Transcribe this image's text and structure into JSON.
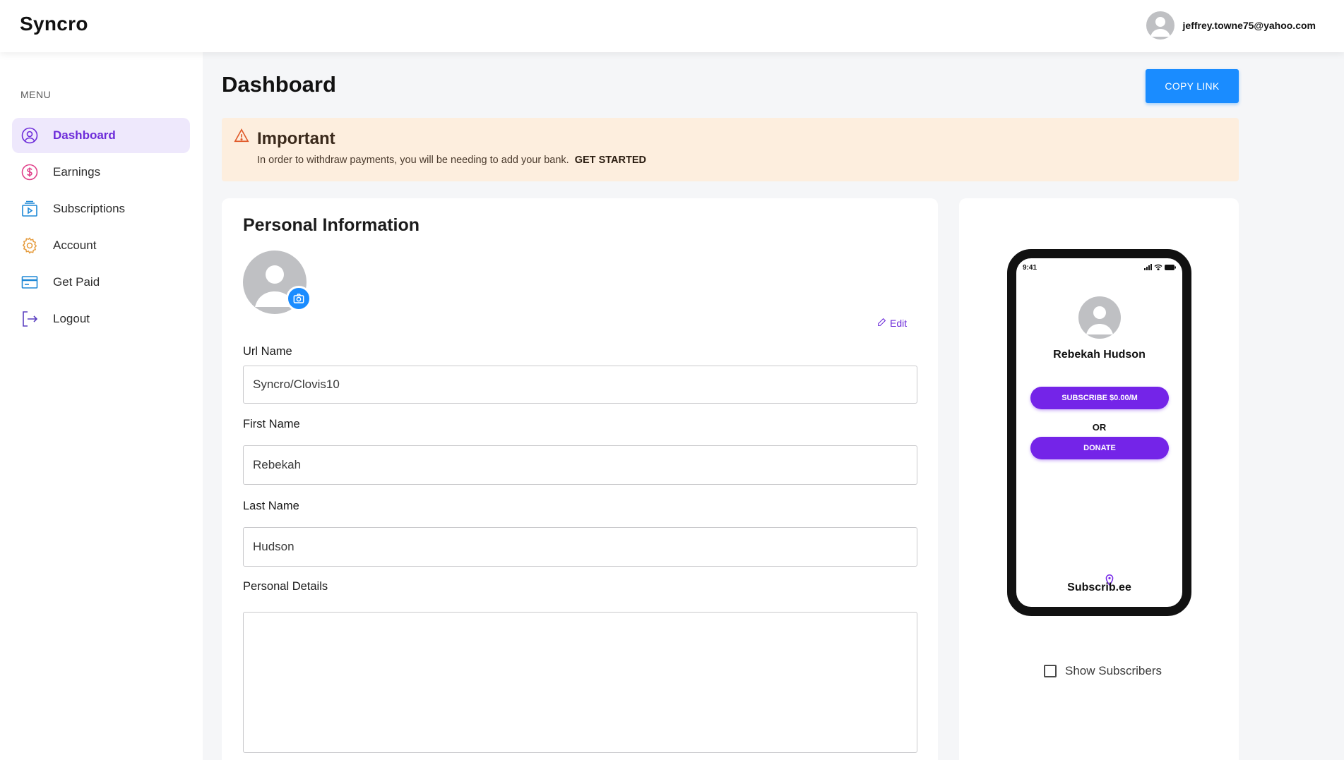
{
  "app": {
    "brand": "Syncro"
  },
  "user": {
    "email": "jeffrey.towne75@yahoo.com",
    "avatar_icon": "user-avatar-icon"
  },
  "sidebar": {
    "menu_label": "MENU",
    "items": [
      {
        "label": "Dashboard",
        "icon": "user-circle-icon",
        "active": true
      },
      {
        "label": "Earnings",
        "icon": "dollar-circle-icon",
        "active": false
      },
      {
        "label": "Subscriptions",
        "icon": "video-play-icon",
        "active": false
      },
      {
        "label": "Account",
        "icon": "gear-icon",
        "active": false
      },
      {
        "label": "Get Paid",
        "icon": "credit-card-icon",
        "active": false
      },
      {
        "label": "Logout",
        "icon": "logout-icon",
        "active": false
      }
    ]
  },
  "header": {
    "title": "Dashboard",
    "copy_link_label": "COPY LINK"
  },
  "alert": {
    "title": "Important",
    "text": "In order to withdraw payments, you will be needing to add your bank.",
    "cta": "GET STARTED",
    "icon": "warning-triangle-icon"
  },
  "personal_info": {
    "title": "Personal Information",
    "edit_label": "Edit",
    "fields": {
      "url_name": {
        "label": "Url Name",
        "value": "Syncro/Clovis10"
      },
      "first_name": {
        "label": "First Name",
        "value": "Rebekah"
      },
      "last_name": {
        "label": "Last Name",
        "value": "Hudson"
      },
      "personal_details": {
        "label": "Personal Details",
        "value": ""
      }
    }
  },
  "preview": {
    "time": "9:41",
    "name": "Rebekah Hudson",
    "subscribe_label": "SUBSCRIBE $0.00/M",
    "or_label": "OR",
    "donate_label": "DONATE",
    "brand": "Subscrib.ee",
    "show_subscribers_label": "Show Subscribers",
    "show_subscribers_checked": false
  },
  "colors": {
    "accent_purple": "#6c2bd9",
    "primary_blue": "#1a8cff",
    "alert_bg": "#fdeede",
    "button_purple": "#7424e8"
  }
}
